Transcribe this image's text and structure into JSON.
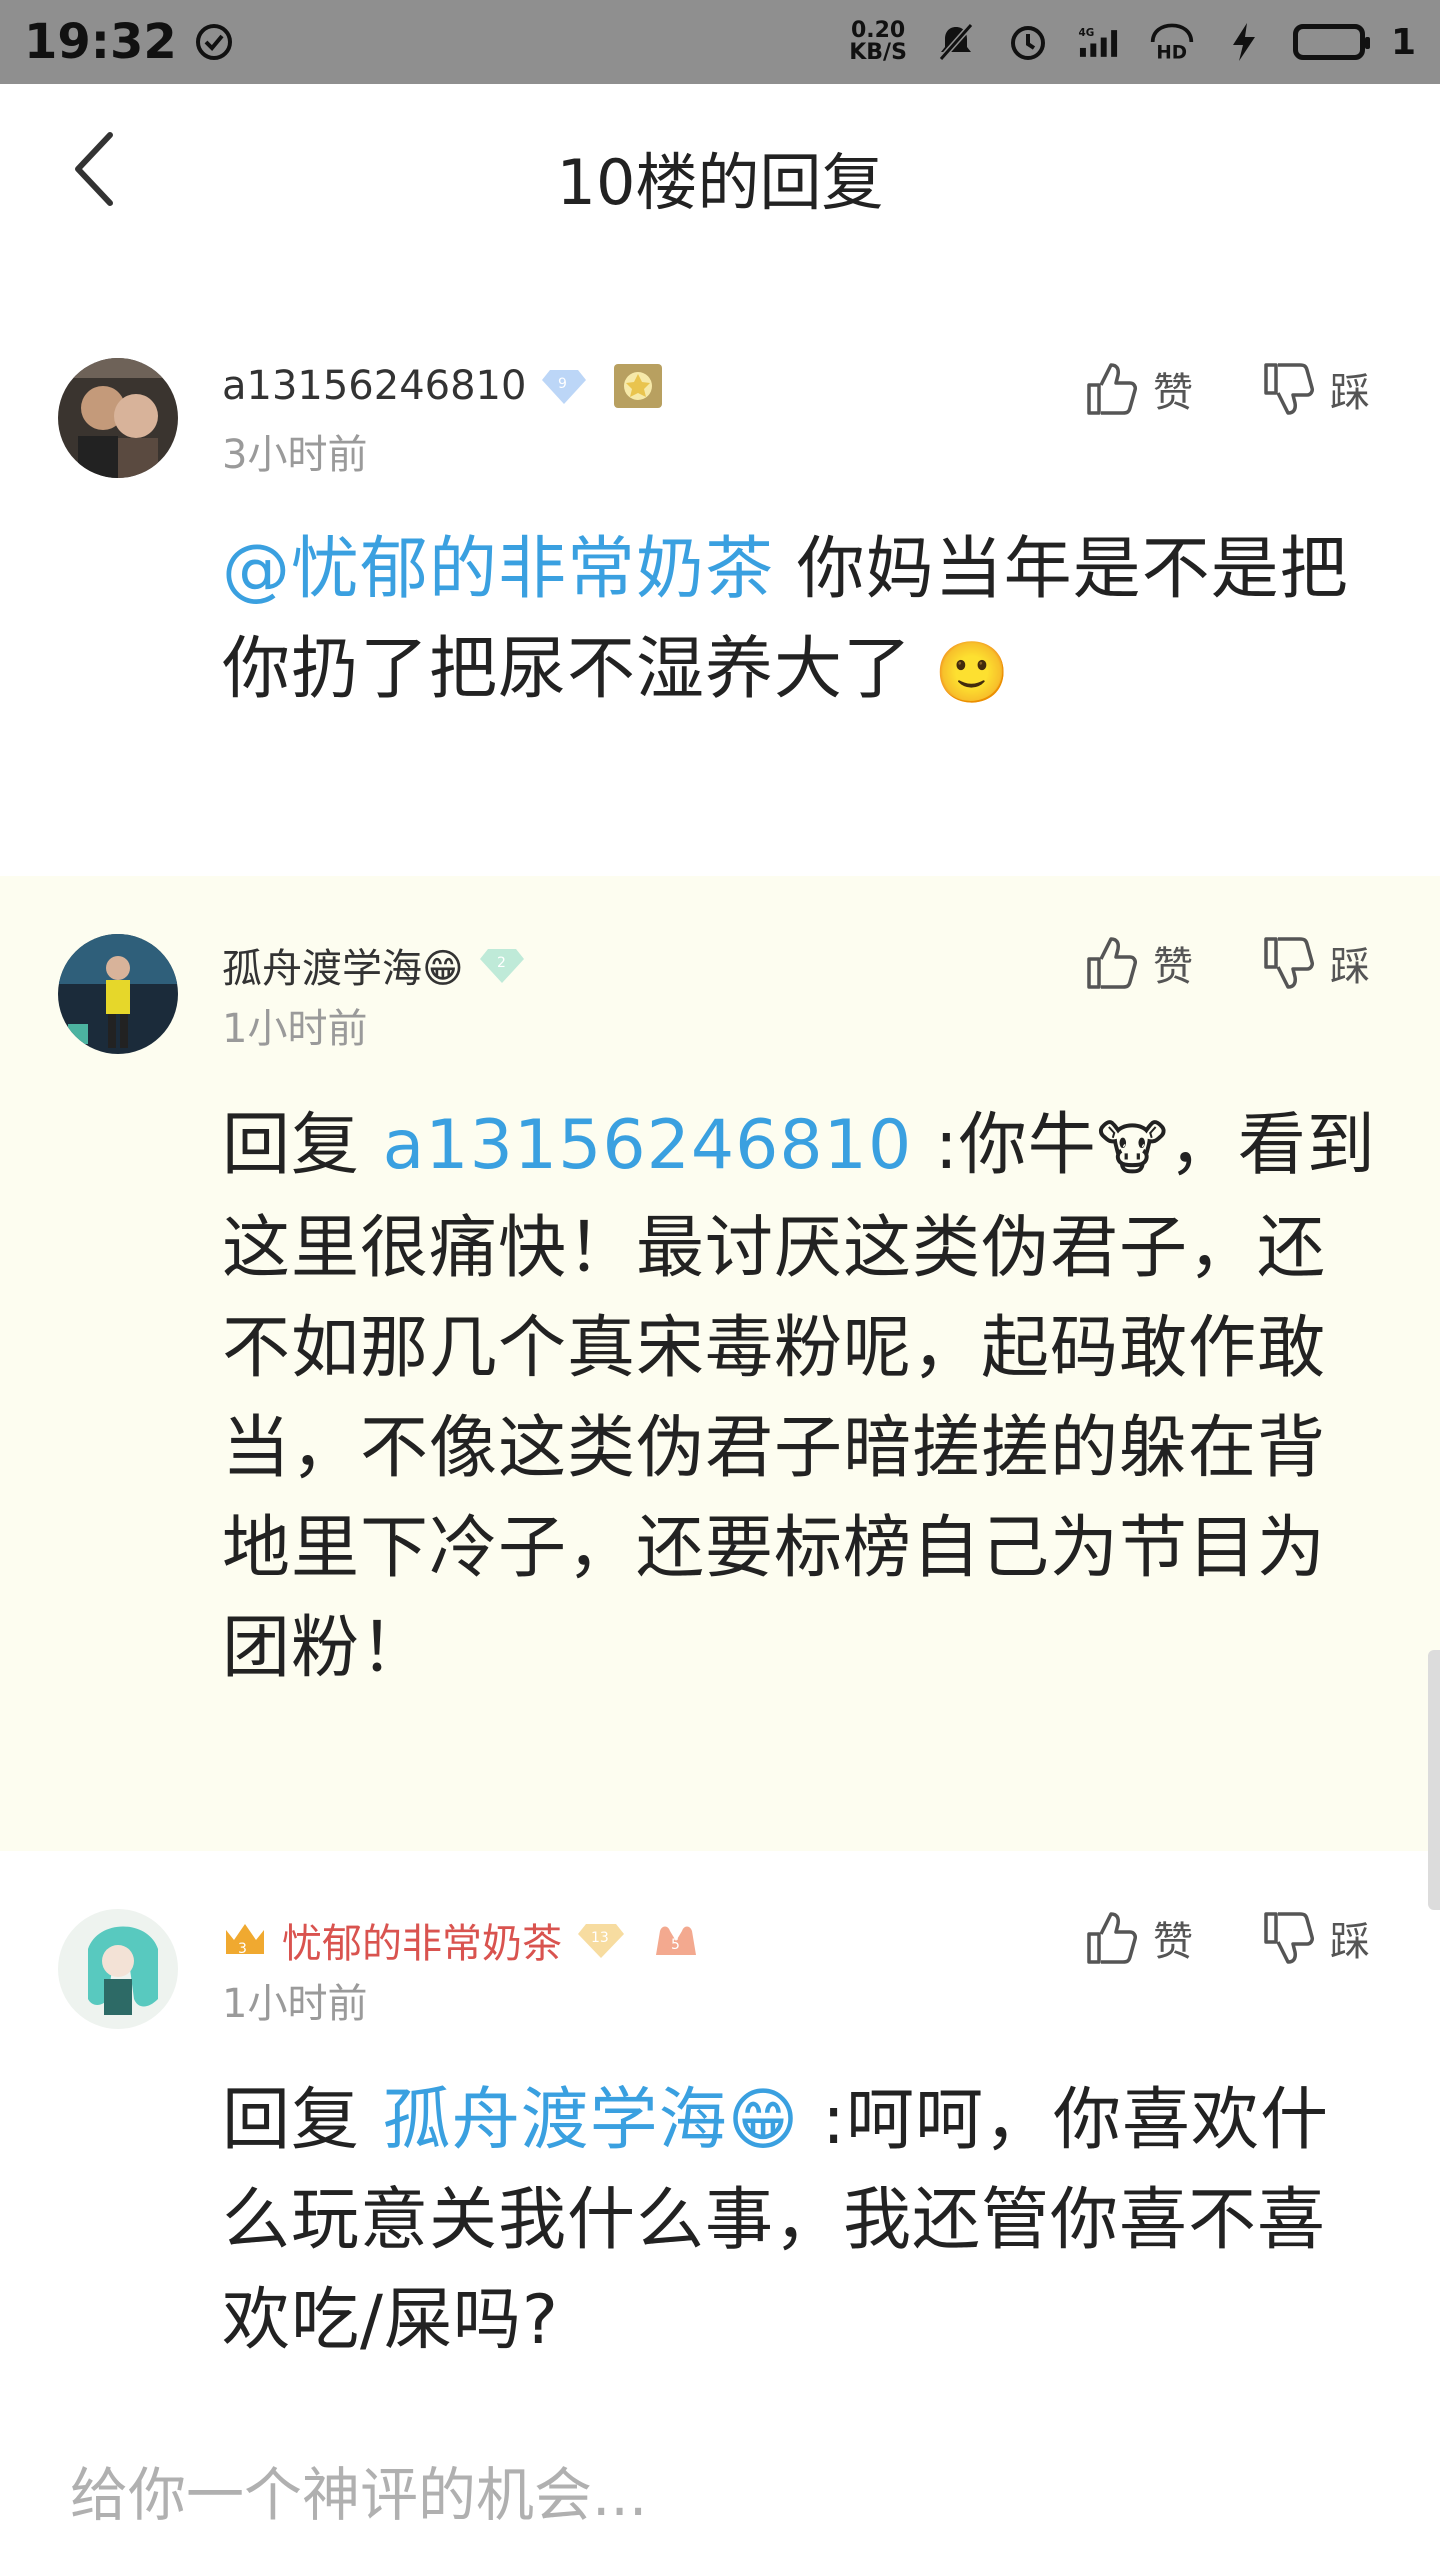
{
  "status_bar": {
    "time": "19:32",
    "net_speed_top": "0.20",
    "net_speed_bottom": "KB/S",
    "network": "4G",
    "hd": "HD",
    "battery_text": "1"
  },
  "header": {
    "title": "10楼的回复"
  },
  "comments": [
    {
      "username": "a13156246810",
      "level": "9",
      "time": "3小时前",
      "like_label": "赞",
      "dislike_label": "踩",
      "mention": "@忧郁的非常奶茶",
      "text": "  你妈当年是不是把你扔了把尿不湿养大了",
      "emoji": "🙂"
    },
    {
      "username": "孤舟渡学海😁",
      "level": "2",
      "time": "1小时前",
      "like_label": "赞",
      "dislike_label": "踩",
      "reply_prefix": "回复",
      "reply_to": "a13156246810",
      "text_a": " :你牛",
      "emoji": "🐮",
      "text_b": "，看到这里很痛快！最讨厌这类伪君子，还不如那几个真宋毒粉呢，起码敢作敢当，不像这类伪君子暗搓搓的躲在背地里下冷子，还要标榜自己为节目为团粉！"
    },
    {
      "username": "忧郁的非常奶茶",
      "level": "13",
      "crown_level": "3",
      "extra_level": "5",
      "time": "1小时前",
      "like_label": "赞",
      "dislike_label": "踩",
      "reply_prefix": "回复",
      "reply_to": "孤舟渡学海😁",
      "text": " :呵呵，你喜欢什么玩意关我什么事，我还管你喜不喜欢吃/屎吗?"
    }
  ],
  "input": {
    "placeholder": "给你一个神评的机会..."
  },
  "colors": {
    "mention": "#3aa0e0",
    "highlight_bg": "#fdfdf0",
    "username_red": "#d9534f",
    "muted": "#9a9a9a"
  }
}
